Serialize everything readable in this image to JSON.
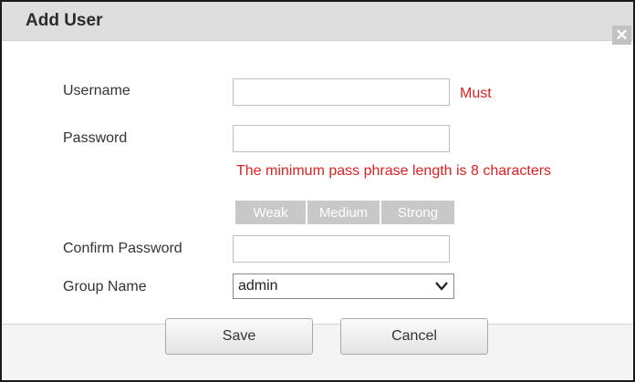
{
  "dialog": {
    "title": "Add User",
    "close_symbol": "✕"
  },
  "form": {
    "username": {
      "label": "Username",
      "value": "",
      "required_text": "Must"
    },
    "password": {
      "label": "Password",
      "value": "",
      "hint": "The minimum pass phrase length is 8 characters"
    },
    "strength": {
      "levels": [
        "Weak",
        "Medium",
        "Strong"
      ]
    },
    "confirm_password": {
      "label": "Confirm Password",
      "value": ""
    },
    "group_name": {
      "label": "Group Name",
      "selected": "admin"
    }
  },
  "buttons": {
    "save": "Save",
    "cancel": "Cancel"
  },
  "colors": {
    "title_bar": "#dedede",
    "warning_text": "#e02020",
    "strength_bar": "#c8c8c8"
  },
  "icons": {
    "close": "close-icon",
    "dropdown": "chevron-down-icon"
  }
}
